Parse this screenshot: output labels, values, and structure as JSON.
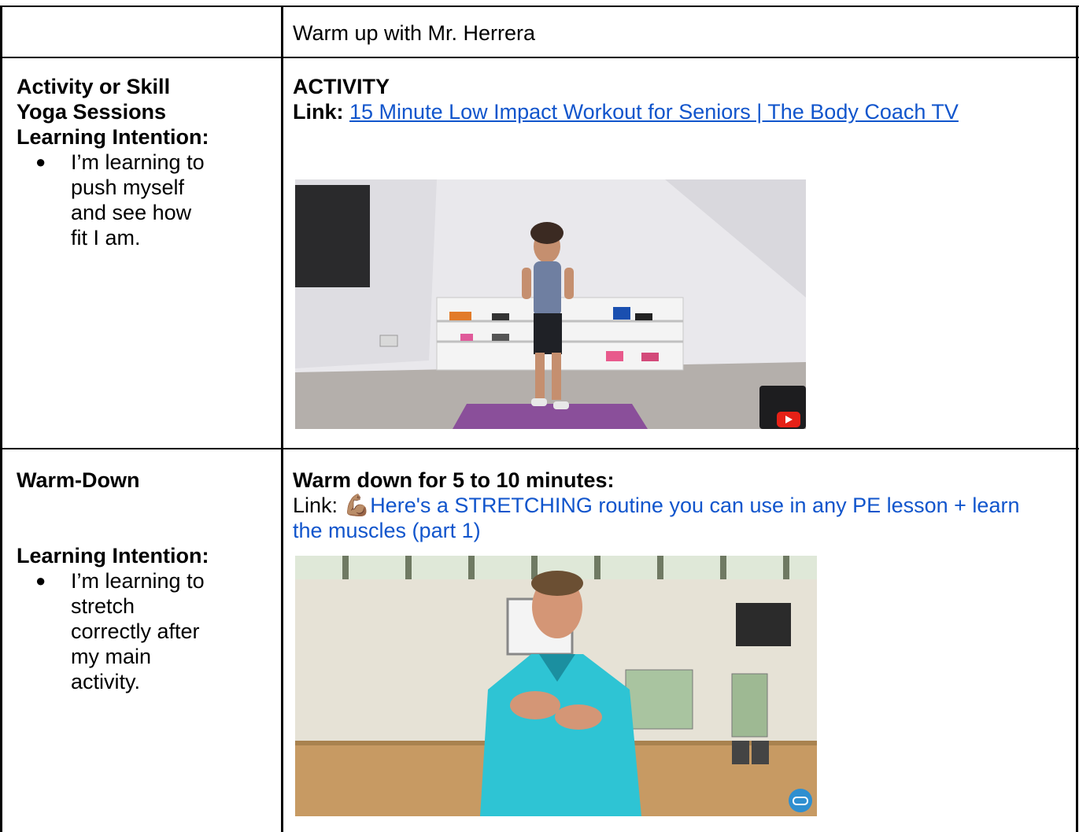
{
  "row1": {
    "right_text": "Warm up with Mr. Herrera"
  },
  "row2": {
    "left": {
      "title": "Activity or Skill",
      "subtitle": "Yoga Sessions",
      "intention_label": "Learning Intention:",
      "bullet": "I’m learning to push myself and see how fit I am."
    },
    "right": {
      "heading": "ACTIVITY",
      "link_label": "Link:",
      "link_text": "15 Minute Low Impact Workout for Seniors | The Body Coach TV",
      "video_icon": "youtube-play-icon"
    }
  },
  "row3": {
    "left": {
      "title": "Warm-Down",
      "intention_label": "Learning Intention:",
      "bullet": "I’m learning to stretch correctly after my main activity."
    },
    "right": {
      "heading": "Warm down for 5 to 10 minutes:",
      "link_label": "Link:",
      "link_emoji": "💪🏽",
      "link_text": "Here's a STRETCHING routine you can use in any PE lesson + learn the muscles (part 1)",
      "video_icon": "channel-logo-icon"
    }
  },
  "colors": {
    "link": "#1155cc",
    "border": "#000000",
    "mat": "#8a4f9a",
    "shirt": "#2ec4d4"
  }
}
